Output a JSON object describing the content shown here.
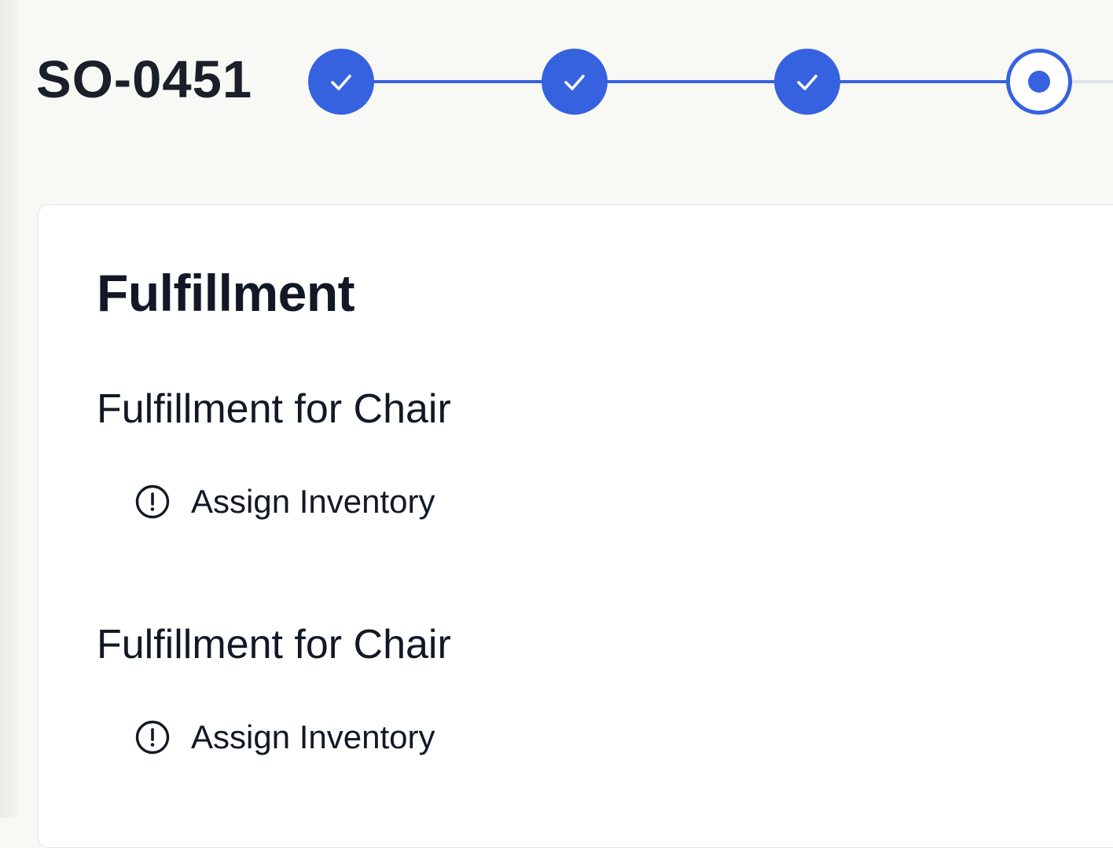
{
  "header": {
    "order_id": "SO-0451"
  },
  "stepper": {
    "steps": [
      {
        "state": "complete",
        "icon": "check-icon"
      },
      {
        "state": "complete",
        "icon": "check-icon"
      },
      {
        "state": "complete",
        "icon": "check-icon"
      },
      {
        "state": "current",
        "icon": "dot-icon"
      }
    ]
  },
  "card": {
    "title": "Fulfillment",
    "sections": [
      {
        "title": "Fulfillment for Chair",
        "task": {
          "label": "Assign Inventory",
          "icon": "alert-circle-icon"
        }
      },
      {
        "title": "Fulfillment for Chair",
        "task": {
          "label": "Assign Inventory",
          "icon": "alert-circle-icon"
        }
      }
    ]
  },
  "colors": {
    "accent": "#3662e0",
    "page_background": "#f8f8f4",
    "card_background": "#ffffff",
    "text": "#121826"
  }
}
